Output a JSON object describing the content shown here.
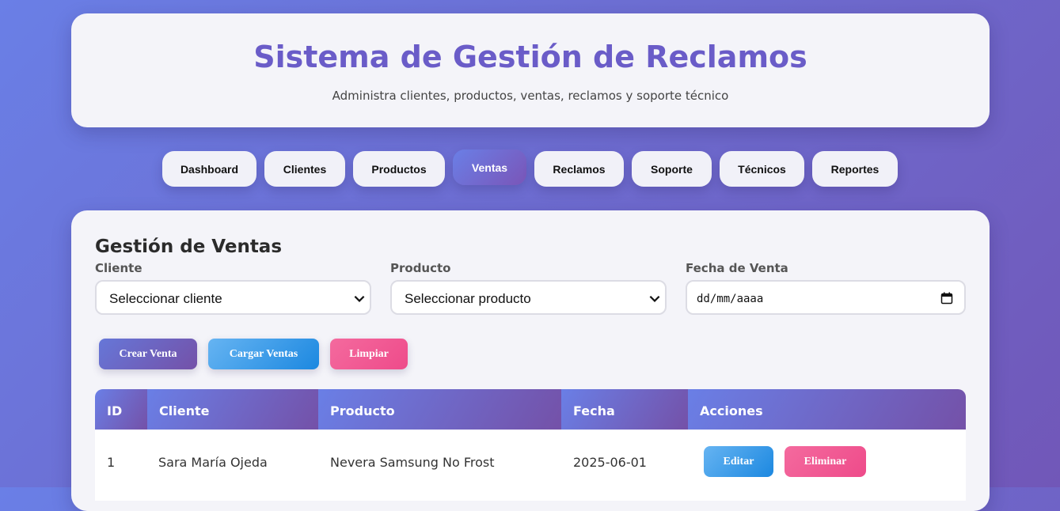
{
  "header": {
    "title": "Sistema de Gestión de Reclamos",
    "subtitle": "Administra clientes, productos, ventas, reclamos y soporte técnico"
  },
  "nav": {
    "active": "Ventas",
    "items": [
      "Dashboard",
      "Clientes",
      "Productos",
      "Ventas",
      "Reclamos",
      "Soporte",
      "Técnicos",
      "Reportes"
    ]
  },
  "ventas": {
    "title": "Gestión de Ventas",
    "form": {
      "cliente_label": "Cliente",
      "cliente_value": "Seleccionar cliente",
      "producto_label": "Producto",
      "producto_value": "Seleccionar producto",
      "fecha_label": "Fecha de Venta",
      "fecha_placeholder": "dd/mm/aaaa"
    },
    "buttons": {
      "crear": "Crear Venta",
      "cargar": "Cargar Ventas",
      "limpiar": "Limpiar"
    },
    "table": {
      "columns": [
        "ID",
        "Cliente",
        "Producto",
        "Fecha",
        "Acciones"
      ],
      "rows": [
        {
          "id": "1",
          "cliente": "Sara María Ojeda",
          "producto": "Nevera Samsung No Frost",
          "fecha": "2025-06-01",
          "edit_label": "Editar",
          "delete_label": "Eliminar"
        }
      ]
    }
  },
  "icons": {
    "select": "chevron-down-icon",
    "date": "calendar-icon"
  },
  "colors": {
    "background_start": "#6a7fe6",
    "background_end": "#7157b8",
    "title": "#6a5cc8",
    "edit_button": "#1c88e0",
    "delete_button": "#ee4b8a"
  }
}
